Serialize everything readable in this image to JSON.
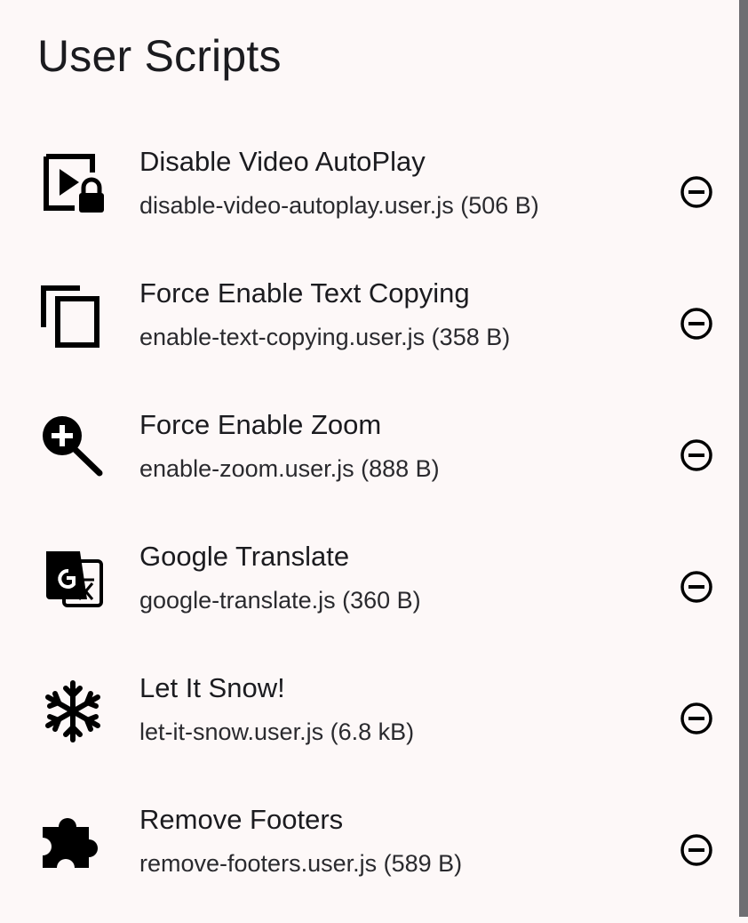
{
  "header": {
    "title": "User Scripts"
  },
  "scripts": [
    {
      "title": "Disable Video AutoPlay",
      "file": "disable-video-autoplay.user.js (506 B)",
      "icon": "video-lock-icon"
    },
    {
      "title": "Force Enable Text Copying",
      "file": "enable-text-copying.user.js (358 B)",
      "icon": "copy-icon"
    },
    {
      "title": "Force Enable Zoom",
      "file": "enable-zoom.user.js (888 B)",
      "icon": "zoom-in-icon"
    },
    {
      "title": "Google Translate",
      "file": "google-translate.js (360 B)",
      "icon": "translate-icon"
    },
    {
      "title": "Let It Snow!",
      "file": "let-it-snow.user.js (6.8 kB)",
      "icon": "snowflake-icon"
    },
    {
      "title": "Remove Footers",
      "file": "remove-footers.user.js (589 B)",
      "icon": "puzzle-piece-icon"
    }
  ],
  "colors": {
    "background": "#fdf8f8",
    "text": "#1b1b1f",
    "scrollbar": "#6e6e72"
  }
}
